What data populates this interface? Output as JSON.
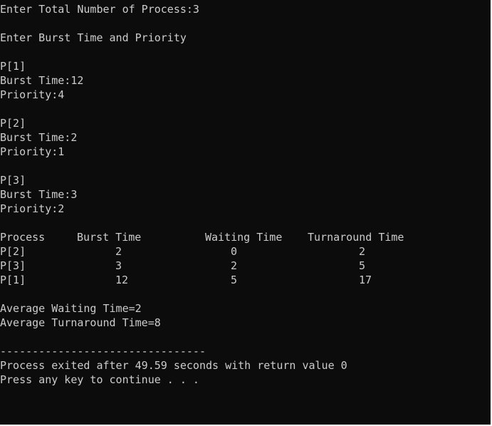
{
  "console": {
    "prompt_total": "Enter Total Number of Process:3",
    "prompt_burst_priority": "Enter Burst Time and Priority",
    "inputs": [
      {
        "label": "P[1]",
        "burst": "Burst Time:12",
        "priority": "Priority:4"
      },
      {
        "label": "P[2]",
        "burst": "Burst Time:2",
        "priority": "Priority:1"
      },
      {
        "label": "P[3]",
        "burst": "Burst Time:3",
        "priority": "Priority:2"
      }
    ],
    "table": {
      "headers": [
        "Process",
        "Burst Time",
        "Waiting Time",
        "Turnaround Time"
      ],
      "rows": [
        [
          "P[2]",
          "2",
          "0",
          "2"
        ],
        [
          "P[3]",
          "3",
          "2",
          "5"
        ],
        [
          "P[1]",
          "12",
          "5",
          "17"
        ]
      ]
    },
    "avg_waiting": "Average Waiting Time=2",
    "avg_turnaround": "Average Turnaround Time=8",
    "separator": "--------------------------------",
    "exit_message": "Process exited after 49.59 seconds with return value 0",
    "continue_message": "Press any key to continue . . ."
  },
  "colors": {
    "background": "#0c0c0c",
    "text": "#cccccc"
  }
}
